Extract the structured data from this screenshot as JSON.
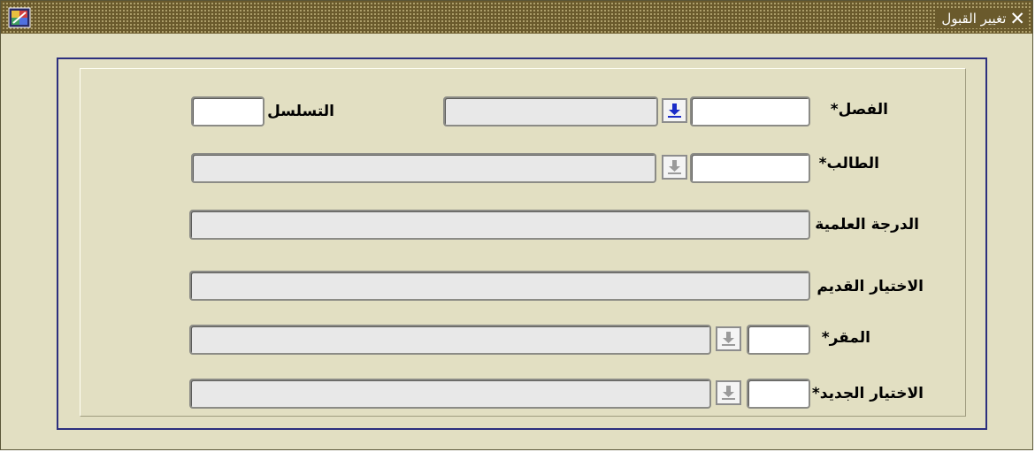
{
  "window": {
    "title": "تغيير القبول",
    "close_icon": "close-icon",
    "app_icon": "oracle-forms-app-icon"
  },
  "form": {
    "semester_label": "الفصل*",
    "sequence_label": "التسلسل",
    "student_label": "الطالب*",
    "degree_label": "الدرجة العلمية",
    "old_choice_label": "الاختيار القديم",
    "course_label": "المقر*",
    "new_choice_label": "الاختيار الجديد*"
  },
  "colors": {
    "titlebar": "#6a5a2c",
    "window_bg": "#e2dfc2",
    "frame_border": "#2c2f7e",
    "active_lov_arrow": "#1a2cc8",
    "inactive_lov_arrow": "#9a9a9a"
  }
}
